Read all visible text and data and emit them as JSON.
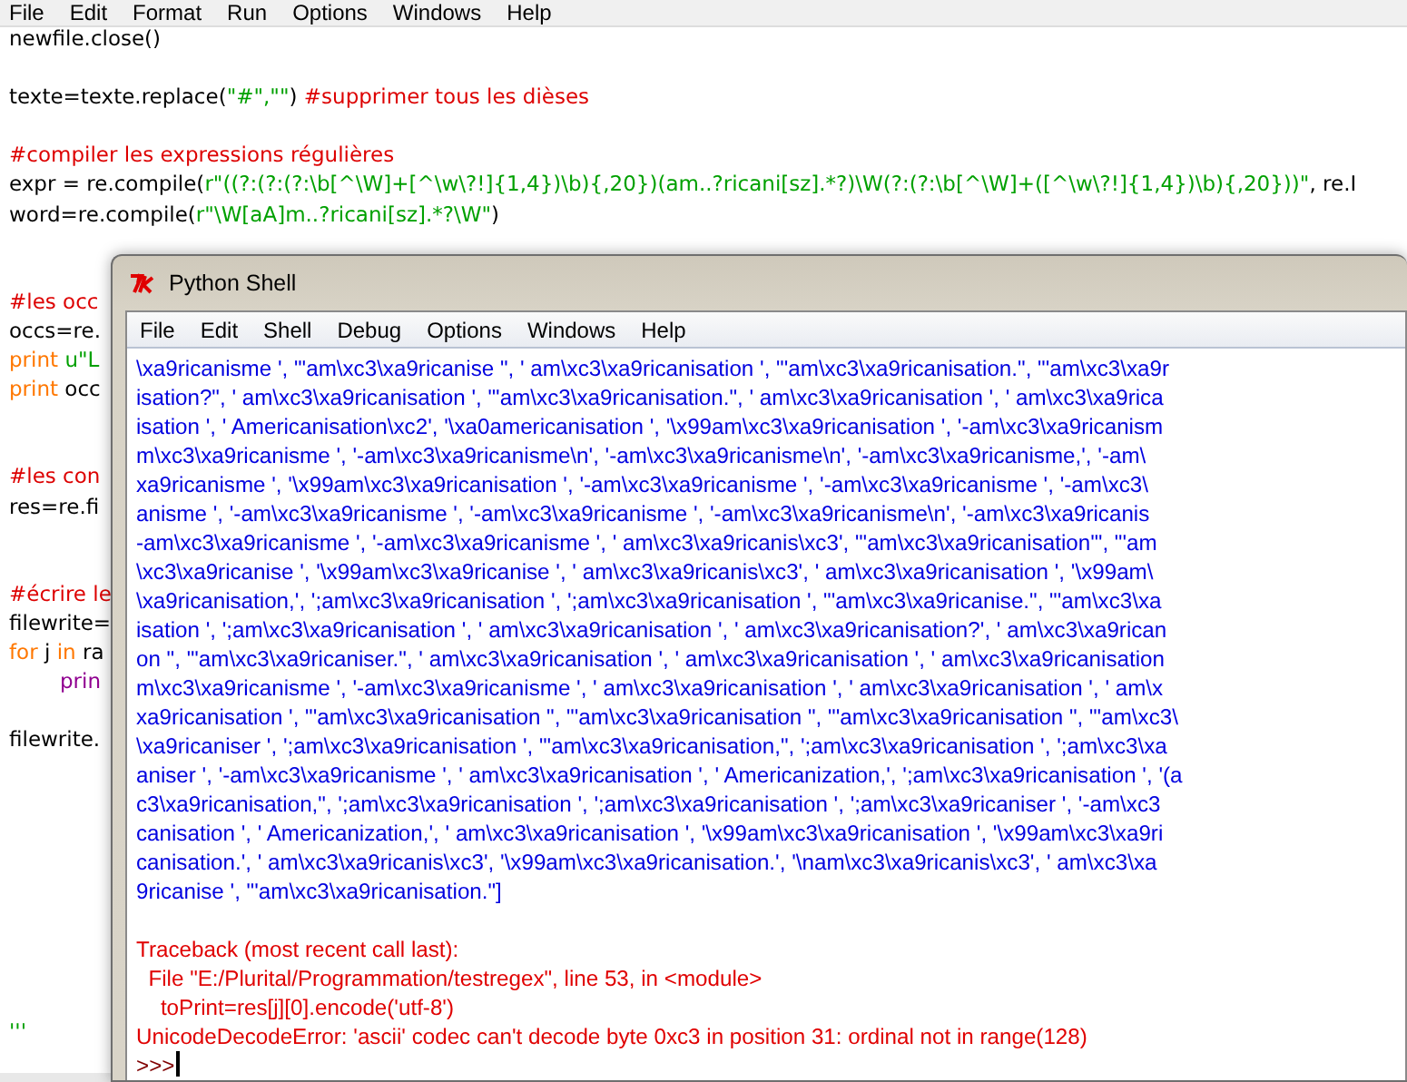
{
  "editor": {
    "menu": [
      "File",
      "Edit",
      "Format",
      "Run",
      "Options",
      "Windows",
      "Help"
    ],
    "lines": [
      {
        "kind": "code",
        "segments": [
          {
            "kind": "code",
            "text": "newfile.close()"
          }
        ]
      },
      {
        "kind": "blank"
      },
      {
        "kind": "code",
        "segments": [
          {
            "kind": "code",
            "text": "texte=texte.replace("
          },
          {
            "kind": "string",
            "text": "\"#\",\"\""
          },
          {
            "kind": "code",
            "text": ") "
          },
          {
            "kind": "comment",
            "text": "#supprimer tous les dièses"
          }
        ]
      },
      {
        "kind": "blank"
      },
      {
        "kind": "code",
        "segments": [
          {
            "kind": "comment",
            "text": "#compiler les expressions régulières"
          }
        ]
      },
      {
        "kind": "code",
        "segments": [
          {
            "kind": "code",
            "text": "expr = re.compile("
          },
          {
            "kind": "string",
            "text": "r\"((?:(?:(?:\\b[^\\W]+[^\\w\\?!]{1,4})\\b){,20})(am..?ricani[sz].*?)\\W(?:(?:\\b[^\\W]+([^\\w\\?!]{1,4})\\b){,20}))\""
          },
          {
            "kind": "code",
            "text": ", re.I"
          }
        ]
      },
      {
        "kind": "code",
        "segments": [
          {
            "kind": "code",
            "text": "word=re.compile("
          },
          {
            "kind": "string",
            "text": "r\"\\W[aA]m..?ricani[sz].*?\\W\""
          },
          {
            "kind": "code",
            "text": ")"
          }
        ]
      },
      {
        "kind": "blank"
      },
      {
        "kind": "blank"
      },
      {
        "kind": "code",
        "segments": [
          {
            "kind": "comment",
            "text": "#les occ"
          }
        ]
      },
      {
        "kind": "code",
        "segments": [
          {
            "kind": "code",
            "text": "occs=re."
          }
        ]
      },
      {
        "kind": "code",
        "segments": [
          {
            "kind": "keyword",
            "text": "print "
          },
          {
            "kind": "string",
            "text": "u\"L"
          }
        ]
      },
      {
        "kind": "code",
        "segments": [
          {
            "kind": "keyword",
            "text": "print"
          },
          {
            "kind": "code",
            "text": " occ"
          }
        ]
      },
      {
        "kind": "blank"
      },
      {
        "kind": "blank"
      },
      {
        "kind": "code",
        "segments": [
          {
            "kind": "comment",
            "text": "#les con"
          }
        ]
      },
      {
        "kind": "code",
        "segments": [
          {
            "kind": "code",
            "text": "res=re.fi"
          }
        ]
      },
      {
        "kind": "blank"
      },
      {
        "kind": "blank"
      },
      {
        "kind": "code",
        "segments": [
          {
            "kind": "comment",
            "text": "#écrire le"
          }
        ]
      },
      {
        "kind": "code",
        "segments": [
          {
            "kind": "code",
            "text": "filewrite="
          }
        ]
      },
      {
        "kind": "code",
        "segments": [
          {
            "kind": "keyword",
            "text": "for"
          },
          {
            "kind": "code",
            "text": " j "
          },
          {
            "kind": "keyword",
            "text": "in"
          },
          {
            "kind": "code",
            "text": " ra"
          }
        ]
      },
      {
        "kind": "indented",
        "segments": [
          {
            "kind": "builtin",
            "text": "prin"
          }
        ]
      },
      {
        "kind": "blank"
      },
      {
        "kind": "code",
        "segments": [
          {
            "kind": "code",
            "text": "filewrite."
          }
        ]
      },
      {
        "kind": "blank"
      },
      {
        "kind": "blank"
      },
      {
        "kind": "blank"
      },
      {
        "kind": "blank"
      },
      {
        "kind": "blank"
      },
      {
        "kind": "blank"
      },
      {
        "kind": "blank"
      },
      {
        "kind": "blank"
      },
      {
        "kind": "blank"
      },
      {
        "kind": "code",
        "segments": [
          {
            "kind": "string",
            "text": "'''"
          }
        ]
      }
    ]
  },
  "shell": {
    "title": "Python Shell",
    "menu": [
      "File",
      "Edit",
      "Shell",
      "Debug",
      "Options",
      "Windows",
      "Help"
    ],
    "lines": [
      {
        "kind": "output",
        "text": "\\xa9ricanisme ', \"'am\\xc3\\xa9ricanise \", ' am\\xc3\\xa9ricanisation ', \"'am\\xc3\\xa9ricanisation.\", \"'am\\xc3\\xa9r"
      },
      {
        "kind": "output",
        "text": "isation?\", ' am\\xc3\\xa9ricanisation ', \"'am\\xc3\\xa9ricanisation.\", ' am\\xc3\\xa9ricanisation ', ' am\\xc3\\xa9rica"
      },
      {
        "kind": "output",
        "text": "isation ', ' Americanisation\\xc2', '\\xa0americanisation ', '\\x99am\\xc3\\xa9ricanisation ', '-am\\xc3\\xa9ricanism"
      },
      {
        "kind": "output",
        "text": "m\\xc3\\xa9ricanisme ', '-am\\xc3\\xa9ricanisme\\n', '-am\\xc3\\xa9ricanisme\\n', '-am\\xc3\\xa9ricanisme,', '-am\\"
      },
      {
        "kind": "output",
        "text": "xa9ricanisme ', '\\x99am\\xc3\\xa9ricanisation ', '-am\\xc3\\xa9ricanisme ', '-am\\xc3\\xa9ricanisme ', '-am\\xc3\\"
      },
      {
        "kind": "output",
        "text": "anisme ', '-am\\xc3\\xa9ricanisme ', '-am\\xc3\\xa9ricanisme ', '-am\\xc3\\xa9ricanisme\\n', '-am\\xc3\\xa9ricanis"
      },
      {
        "kind": "output",
        "text": "-am\\xc3\\xa9ricanisme ', '-am\\xc3\\xa9ricanisme ', ' am\\xc3\\xa9ricanis\\xc3', \"'am\\xc3\\xa9ricanisation'\", \"'am"
      },
      {
        "kind": "output",
        "text": "\\xc3\\xa9ricanise ', '\\x99am\\xc3\\xa9ricanise ', ' am\\xc3\\xa9ricanis\\xc3', ' am\\xc3\\xa9ricanisation ', '\\x99am\\"
      },
      {
        "kind": "output",
        "text": "\\xa9ricanisation,', ';am\\xc3\\xa9ricanisation ', ';am\\xc3\\xa9ricanisation ', \"'am\\xc3\\xa9ricanise.\", \"'am\\xc3\\xa"
      },
      {
        "kind": "output",
        "text": "isation ', ';am\\xc3\\xa9ricanisation ', ' am\\xc3\\xa9ricanisation ', ' am\\xc3\\xa9ricanisation?', ' am\\xc3\\xa9rican"
      },
      {
        "kind": "output",
        "text": "on \", \"'am\\xc3\\xa9ricaniser.\", ' am\\xc3\\xa9ricanisation ', ' am\\xc3\\xa9ricanisation ', ' am\\xc3\\xa9ricanisation"
      },
      {
        "kind": "output",
        "text": "m\\xc3\\xa9ricanisme ', '-am\\xc3\\xa9ricanisme ', ' am\\xc3\\xa9ricanisation ', ' am\\xc3\\xa9ricanisation ', ' am\\x"
      },
      {
        "kind": "output",
        "text": "xa9ricanisation ', \"'am\\xc3\\xa9ricanisation \", \"'am\\xc3\\xa9ricanisation \", \"'am\\xc3\\xa9ricanisation \", \"'am\\xc3\\"
      },
      {
        "kind": "output",
        "text": "\\xa9ricaniser ', ';am\\xc3\\xa9ricanisation ', \"'am\\xc3\\xa9ricanisation,\", ';am\\xc3\\xa9ricanisation ', ';am\\xc3\\xa"
      },
      {
        "kind": "output",
        "text": "aniser ', '-am\\xc3\\xa9ricanisme ', ' am\\xc3\\xa9ricanisation ', ' Americanization,', ';am\\xc3\\xa9ricanisation ', '(a"
      },
      {
        "kind": "output",
        "text": "c3\\xa9ricanisation,\", ';am\\xc3\\xa9ricanisation ', ';am\\xc3\\xa9ricanisation ', ';am\\xc3\\xa9ricaniser ', '-am\\xc3"
      },
      {
        "kind": "output",
        "text": "canisation ', ' Americanization,', ' am\\xc3\\xa9ricanisation ', '\\x99am\\xc3\\xa9ricanisation ', '\\x99am\\xc3\\xa9ri"
      },
      {
        "kind": "output",
        "text": "canisation.', ' am\\xc3\\xa9ricanis\\xc3', '\\x99am\\xc3\\xa9ricanisation.', '\\nam\\xc3\\xa9ricanis\\xc3', ' am\\xc3\\xa"
      },
      {
        "kind": "output",
        "text": "9ricanise ', \"'am\\xc3\\xa9ricanisation.\"]"
      },
      {
        "kind": "blank"
      },
      {
        "kind": "error",
        "text": "Traceback (most recent call last):"
      },
      {
        "kind": "error",
        "text": "  File \"E:/Plurital/Programmation/testregex\", line 53, in <module>"
      },
      {
        "kind": "error",
        "text": "    toPrint=res[j][0].encode('utf-8')"
      },
      {
        "kind": "error",
        "text": "UnicodeDecodeError: 'ascii' codec can't decode byte 0xc3 in position 31: ordinal not in range(128)"
      }
    ],
    "prompt": ">>>"
  }
}
